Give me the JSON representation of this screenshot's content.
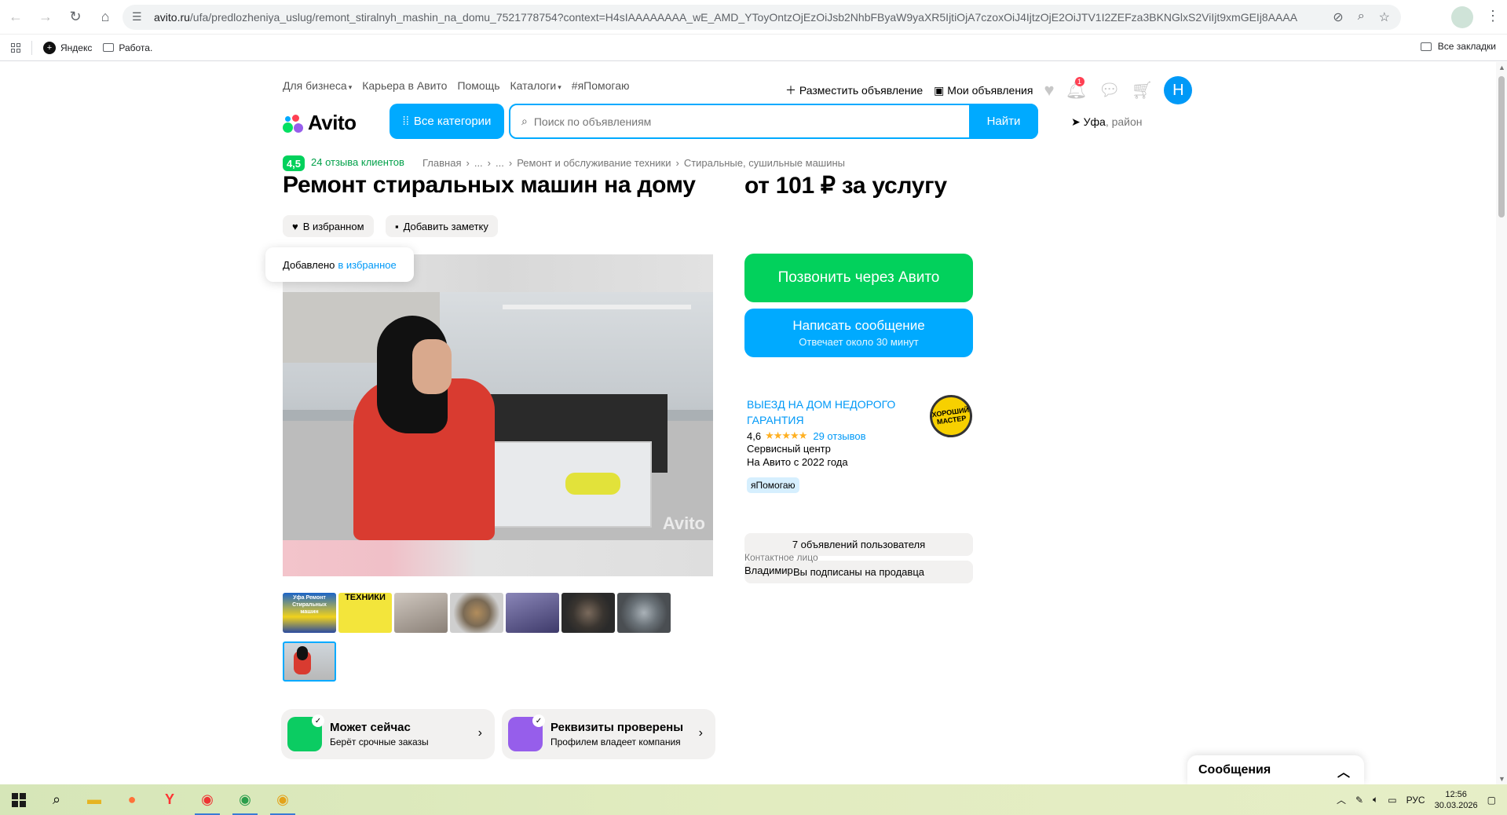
{
  "browser": {
    "url_host": "avito.ru",
    "url_rest": "/ufa/predlozheniya_uslug/remont_stiralnyh_mashin_na_domu_7521778754?context=H4sIAAAAAAAA_wE_AMD_YToyOntzOjEzOiJsb2NhbFByaW9yaXR5IjtiOjA7czoxOiJ4IjtzOjE2OiJTV1I2ZEFza3BKNGlxS2ViIjt9xmGEIj8AAAA",
    "profile_initial": "",
    "bookmarks": [
      "Яндекс",
      "Работа."
    ],
    "all_bookmarks": "Все закладки"
  },
  "topnav": {
    "items": [
      "Для бизнеса",
      "Карьера в Авито",
      "Помощь",
      "Каталоги",
      "#яПомогаю"
    ],
    "post_ad": "Разместить объявление",
    "my_ads": "Мои объявления",
    "notif_count": "1",
    "avatar_letter": "Н"
  },
  "header": {
    "logo": "Avito",
    "all_categories": "Все категории",
    "search_placeholder": "Поиск по объявлениям",
    "search_button": "Найти",
    "location_city": "Уфа",
    "location_rest": ", район"
  },
  "listing": {
    "rating": "4,5",
    "reviews_link": "24 отзыва клиентов",
    "breadcrumbs": [
      "Главная",
      "...",
      "...",
      "Ремонт и обслуживание техники",
      "Стиральные, сушильные машины"
    ],
    "title": "Ремонт стиральных машин на дому",
    "price": "от 101 ₽ за услугу",
    "favorite_chip": "В избранном",
    "note_chip": "Добавить заметку",
    "tooltip_text": "Добавлено",
    "tooltip_link": "в избранное",
    "watermark": "Avito",
    "thumb1_text": "Уфа Ремонт Стиральных машин",
    "thumb2_text": "ТЕХНИКИ"
  },
  "features": [
    {
      "title": "Может сейчас",
      "subtitle": "Берёт срочные заказы"
    },
    {
      "title": "Реквизиты проверены",
      "subtitle": "Профилем владеет компания"
    }
  ],
  "contact": {
    "call_button": "Позвонить через Авито",
    "message_button": "Написать сообщение",
    "message_sub": "Отвечает около 30 минут",
    "seller_name": "ВЫЕЗД НА ДОМ НЕДОРОГО ГАРАНТИЯ",
    "seller_badge": "ХОРОШИЙ МАСТЕР",
    "seller_rating": "4,6",
    "seller_stars": "★★★★★",
    "seller_reviews": "29 отзывов",
    "seller_type": "Сервисный центр",
    "seller_since": "На Авито с 2022 года",
    "tag": "яПомогаю",
    "ads_button": "7 объявлений пользователя",
    "subscribed_button": "Вы подписаны на продавца",
    "contact_label": "Контактное лицо",
    "contact_name": "Владимир"
  },
  "messages_panel": "Сообщения",
  "taskbar": {
    "lang": "РУС",
    "time": "12:56",
    "date": "30.03.2026"
  },
  "colors": {
    "avito_blue": "#00aaff",
    "avito_green": "#02d15c",
    "link_blue": "#0099f7"
  }
}
